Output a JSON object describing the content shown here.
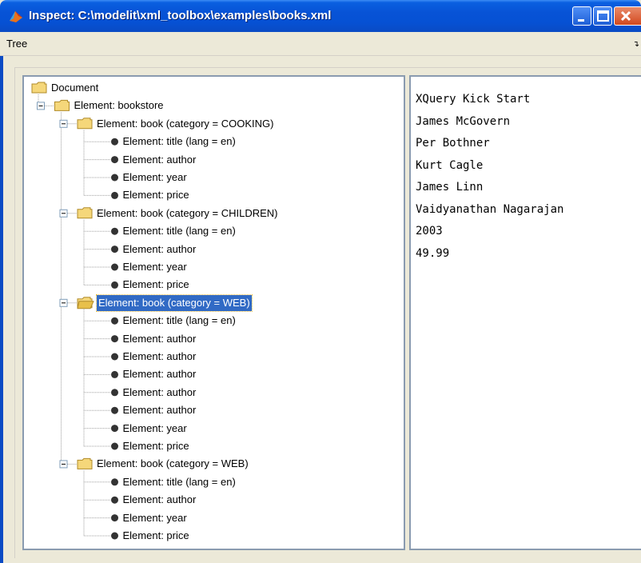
{
  "window": {
    "title": "Inspect: C:\\modelit\\xml_toolbox\\examples\\books.xml"
  },
  "menubar": {
    "tree_menu": "Tree"
  },
  "tree": {
    "nodes": [
      {
        "label": "Document",
        "level": 0,
        "kind": "folder",
        "expander": "none"
      },
      {
        "label": "Element: bookstore",
        "level": 1,
        "kind": "folder",
        "expander": "minus"
      },
      {
        "label": "Element: book (category = COOKING)",
        "level": 2,
        "kind": "folder",
        "expander": "minus"
      },
      {
        "label": "Element: title (lang = en)",
        "level": 3,
        "kind": "leaf"
      },
      {
        "label": "Element: author",
        "level": 3,
        "kind": "leaf"
      },
      {
        "label": "Element: year",
        "level": 3,
        "kind": "leaf"
      },
      {
        "label": "Element: price",
        "level": 3,
        "kind": "leaf"
      },
      {
        "label": "Element: book (category = CHILDREN)",
        "level": 2,
        "kind": "folder",
        "expander": "minus"
      },
      {
        "label": "Element: title (lang = en)",
        "level": 3,
        "kind": "leaf"
      },
      {
        "label": "Element: author",
        "level": 3,
        "kind": "leaf"
      },
      {
        "label": "Element: year",
        "level": 3,
        "kind": "leaf"
      },
      {
        "label": "Element: price",
        "level": 3,
        "kind": "leaf"
      },
      {
        "label": "Element: book (category = WEB)",
        "level": 2,
        "kind": "folder",
        "expander": "minus",
        "selected": true
      },
      {
        "label": "Element: title (lang = en)",
        "level": 3,
        "kind": "leaf"
      },
      {
        "label": "Element: author",
        "level": 3,
        "kind": "leaf"
      },
      {
        "label": "Element: author",
        "level": 3,
        "kind": "leaf"
      },
      {
        "label": "Element: author",
        "level": 3,
        "kind": "leaf"
      },
      {
        "label": "Element: author",
        "level": 3,
        "kind": "leaf"
      },
      {
        "label": "Element: author",
        "level": 3,
        "kind": "leaf"
      },
      {
        "label": "Element: year",
        "level": 3,
        "kind": "leaf"
      },
      {
        "label": "Element: price",
        "level": 3,
        "kind": "leaf"
      },
      {
        "label": "Element: book (category = WEB)",
        "level": 2,
        "kind": "folder",
        "expander": "minus"
      },
      {
        "label": "Element: title (lang = en)",
        "level": 3,
        "kind": "leaf"
      },
      {
        "label": "Element: author",
        "level": 3,
        "kind": "leaf"
      },
      {
        "label": "Element: year",
        "level": 3,
        "kind": "leaf"
      },
      {
        "label": "Element: price",
        "level": 3,
        "kind": "leaf"
      }
    ]
  },
  "content": {
    "lines": [
      "XQuery Kick Start",
      "James McGovern",
      "Per Bothner",
      "Kurt Cagle",
      "James Linn",
      "Vaidyanathan Nagarajan",
      "2003",
      "49.99"
    ]
  },
  "colors": {
    "titlebar": "#0651d4",
    "selection": "#316ac5",
    "folder": "#f5d77a",
    "panel_border": "#8a9bb0"
  },
  "icons": {
    "app": "matlab-icon",
    "folder": "folder-icon",
    "leaf": "bullet-icon",
    "expand": "minus-box-icon"
  }
}
